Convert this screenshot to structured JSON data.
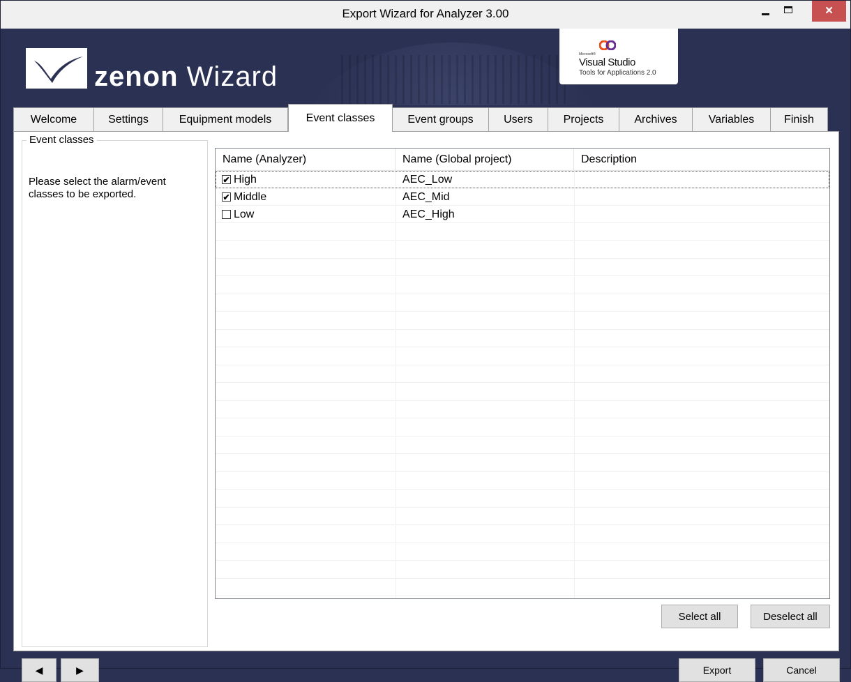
{
  "window": {
    "title": "Export Wizard for Analyzer 3.00",
    "close_glyph": "×"
  },
  "header": {
    "brand_bold": "zenon",
    "brand_regular": "Wizard",
    "vs_microsoft": "Microsoft®",
    "vs_name": "Visual Studio",
    "vs_tagline": "Tools for Applications 2.0"
  },
  "tabs": [
    {
      "label": "Welcome",
      "active": false
    },
    {
      "label": "Settings",
      "active": false
    },
    {
      "label": "Equipment models",
      "active": false
    },
    {
      "label": "Event classes",
      "active": true
    },
    {
      "label": "Event groups",
      "active": false
    },
    {
      "label": "Users",
      "active": false
    },
    {
      "label": "Projects",
      "active": false
    },
    {
      "label": "Archives",
      "active": false
    },
    {
      "label": "Variables",
      "active": false
    },
    {
      "label": "Finish",
      "active": false
    }
  ],
  "panel": {
    "group_title": "Event classes",
    "description": "Please select the alarm/event classes to be exported."
  },
  "grid": {
    "columns": [
      "Name (Analyzer)",
      "Name (Global project)",
      "Description"
    ],
    "rows": [
      {
        "checked": true,
        "name": "High",
        "global": "AEC_Low",
        "description": ""
      },
      {
        "checked": true,
        "name": "Middle",
        "global": "AEC_Mid",
        "description": ""
      },
      {
        "checked": false,
        "name": "Low",
        "global": "AEC_High",
        "description": ""
      }
    ]
  },
  "buttons": {
    "select_all": "Select all",
    "deselect_all": "Deselect all",
    "prev": "◀",
    "next": "▶",
    "export": "Export",
    "cancel": "Cancel"
  },
  "colors": {
    "frame": "#2b3152",
    "close_button": "#c75050"
  },
  "icons": [
    "logo-swoosh-icon",
    "visual-studio-icon",
    "minimize-icon",
    "maximize-icon",
    "close-icon",
    "checkbox-icon",
    "arrow-left-icon",
    "arrow-right-icon"
  ]
}
